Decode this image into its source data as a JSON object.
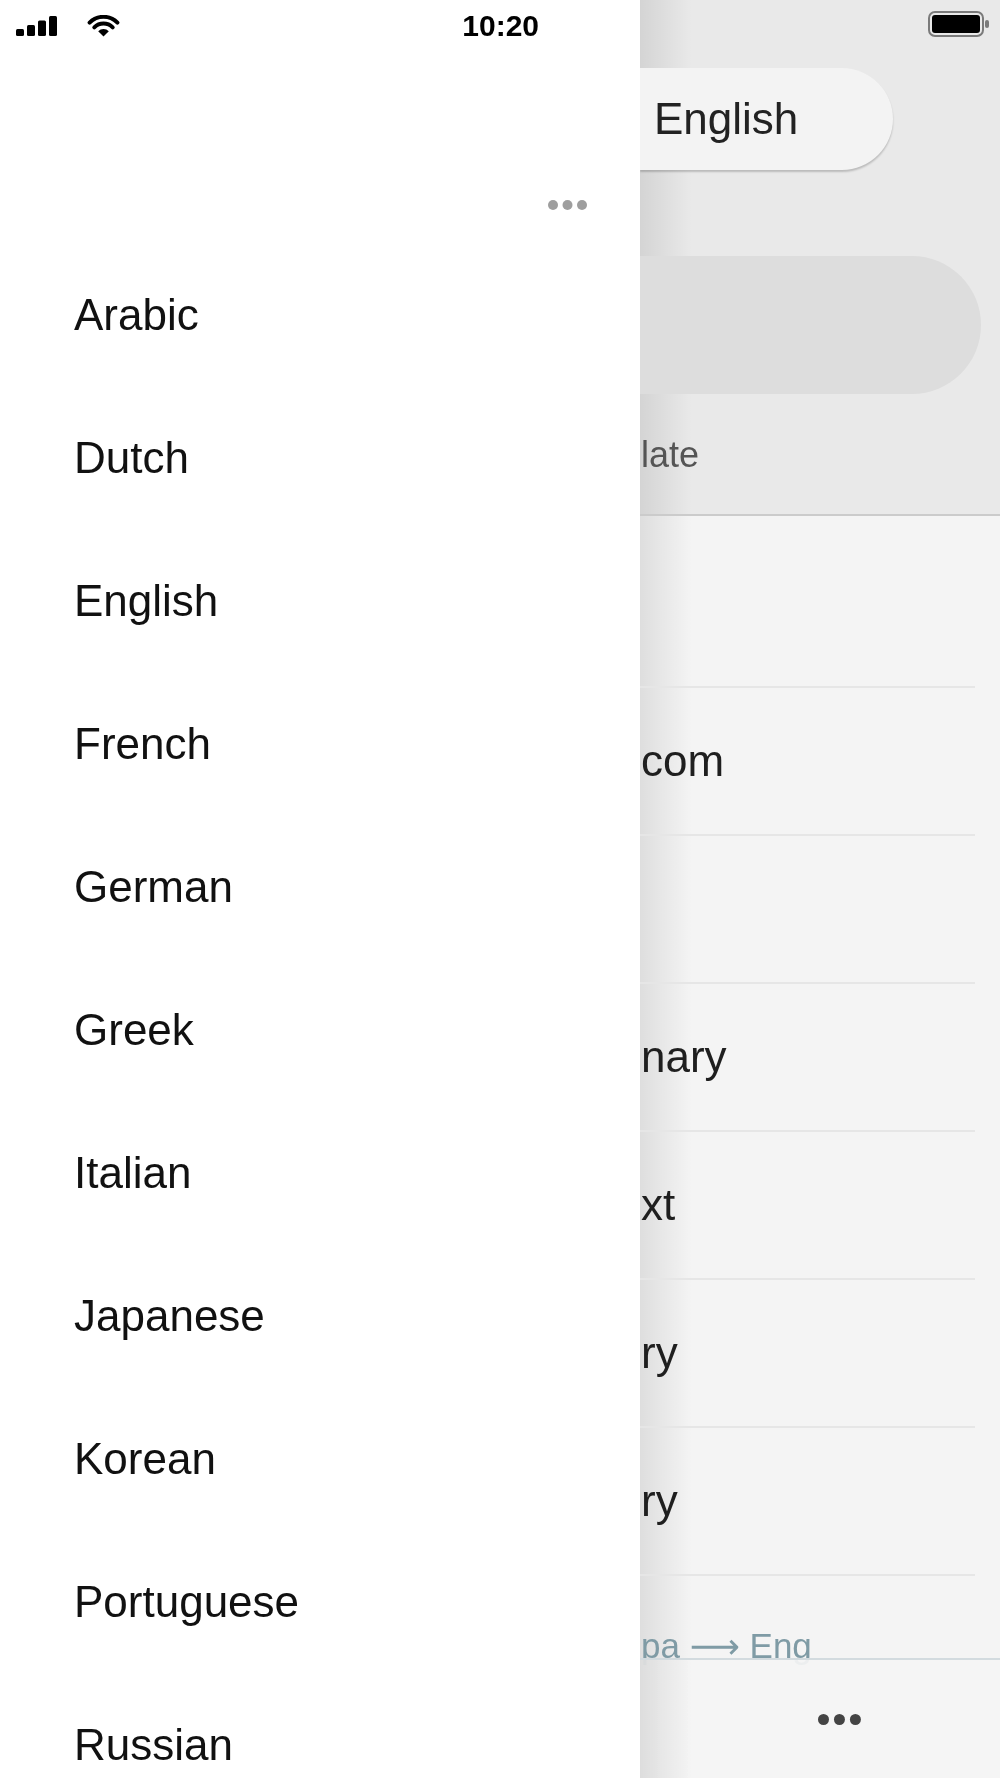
{
  "status_bar": {
    "time": "10:20"
  },
  "drawer": {
    "languages": [
      "Arabic",
      "Dutch",
      "English",
      "French",
      "German",
      "Greek",
      "Italian",
      "Japanese",
      "Korean",
      "Portuguese",
      "Russian"
    ]
  },
  "main": {
    "language_button": "English",
    "caption": "late",
    "rows": [
      {
        "kind": "blank"
      },
      {
        "kind": "text",
        "text": "com"
      },
      {
        "kind": "blank"
      },
      {
        "kind": "text",
        "text": "nary"
      },
      {
        "kind": "text",
        "text": "xt"
      },
      {
        "kind": "text",
        "text": "ry"
      },
      {
        "kind": "text",
        "text": "ry"
      }
    ],
    "direction_hint": "pa ⟶ Eng"
  }
}
